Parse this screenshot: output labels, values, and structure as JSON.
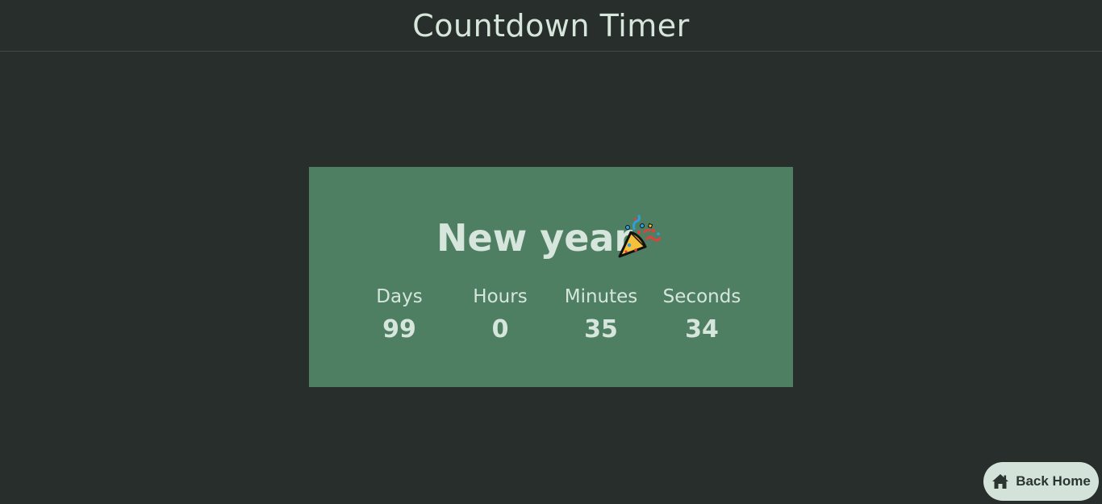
{
  "header": {
    "title": "Countdown Timer"
  },
  "card": {
    "title": "New year",
    "icon": "party-popper-icon",
    "background": "#4e7f63",
    "units": [
      {
        "label": "Days",
        "value": "99"
      },
      {
        "label": "Hours",
        "value": "0"
      },
      {
        "label": "Minutes",
        "value": "35"
      },
      {
        "label": "Seconds",
        "value": "34"
      }
    ]
  },
  "back_home": {
    "label": "Back Home",
    "icon": "home-icon"
  },
  "colors": {
    "background": "#282e2b",
    "text": "#d6e6dc",
    "button": "#d4e3da"
  }
}
